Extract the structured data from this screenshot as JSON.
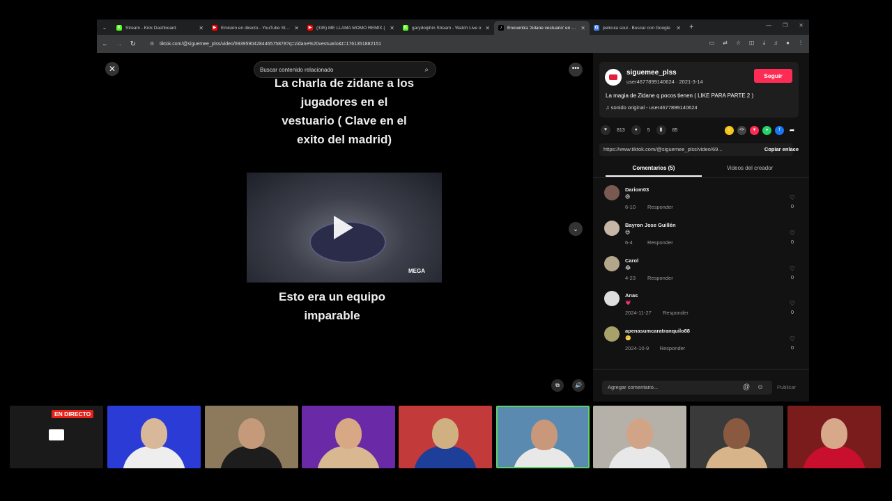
{
  "browser": {
    "tabs": [
      {
        "title": "Stream - Kick Dashboard",
        "fav_color": "#53fc18",
        "fav_char": "K",
        "active": false
      },
      {
        "title": "Emisión en directo - YouTube Studio",
        "fav_color": "#ff0000",
        "fav_char": "▶",
        "active": false
      },
      {
        "title": "(335) ME LLAMA MOMO REMIX (",
        "fav_color": "#ff0000",
        "fav_char": "▶",
        "active": false
      },
      {
        "title": "garydolphin Stream - Watch Live o",
        "fav_color": "#53fc18",
        "fav_char": "K",
        "active": false
      },
      {
        "title": "Encuentra 'zidane vestuario' en TikTok",
        "fav_color": "#000000",
        "fav_char": "♪",
        "active": true
      },
      {
        "title": "pelicula soul - Buscar con Google",
        "fav_color": "#4285f4",
        "fav_char": "G",
        "active": false
      }
    ],
    "url": "tiktok.com/@siguemee_plss/video/6939590428446575878?q=zidane%20vestuario&t=1761351882151"
  },
  "video": {
    "search_placeholder": "Buscar contenido relacionado",
    "title_lines": [
      "La charla de zidane a los",
      "jugadores en el",
      "vestuario ( Clave en el",
      "exito del madrid)"
    ],
    "subtitle_lines": [
      "Esto era un equipo",
      "imparable"
    ],
    "clip_watermark": "MEGA"
  },
  "author": {
    "username": "siguemee_plss",
    "meta": "user4677899140624 · 2021-3-14",
    "follow_label": "Seguir",
    "description": "La magia de Zidane q pocos tienen ( LIKE PARA PARTE 2 )",
    "sound": "sonido original - user4677899140624"
  },
  "stats": {
    "likes": "813",
    "comments": "5",
    "saves": "85"
  },
  "share": {
    "link": "https://www.tiktok.com/@siguemee_plss/video/69...",
    "copy_label": "Copiar enlace"
  },
  "panel_tabs": {
    "comments": "Comentarios (5)",
    "creator": "Videos del creador"
  },
  "comments": [
    {
      "name": "Dariom03",
      "emoji": "😄",
      "date": "6-10",
      "reply": "Responder",
      "likes": "0",
      "avatar": "#7a5a50"
    },
    {
      "name": "Bayron Jose Guillén",
      "emoji": "😍",
      "date": "6-4",
      "reply": "Responder",
      "likes": "0",
      "avatar": "#c7b5a5"
    },
    {
      "name": "Carol",
      "emoji": "😂",
      "date": "4-23",
      "reply": "Responder",
      "likes": "0",
      "avatar": "#b3a68a"
    },
    {
      "name": "Anas",
      "emoji": "💗",
      "date": "2024-11-27",
      "reply": "Responder",
      "likes": "0",
      "avatar": "#dedede"
    },
    {
      "name": "apenasumcaratranquilo88",
      "emoji": "😬",
      "date": "2024-10-9",
      "reply": "Responder",
      "likes": "0",
      "avatar": "#a8a26a"
    }
  ],
  "add_comment": {
    "placeholder": "Agregar comentario...",
    "publish": "Publicar"
  },
  "overlay": {
    "live_badge": "EN DIRECTO",
    "cams": [
      {
        "bg": "#1a1a1a",
        "skin": "#333",
        "shirt": "#222"
      },
      {
        "bg": "#2b3bd6",
        "skin": "#d9b89a",
        "shirt": "#eeeeee"
      },
      {
        "bg": "#8d7a5c",
        "skin": "#c49a7a",
        "shirt": "#1d1d1d"
      },
      {
        "bg": "#6a2aa8",
        "skin": "#d8a884",
        "shirt": "#d8b890"
      },
      {
        "bg": "#c23a3a",
        "skin": "#d0b080",
        "shirt": "#1d3f9a"
      },
      {
        "bg": "#5a8ab0",
        "skin": "#c9987a",
        "shirt": "#e8e8e8"
      },
      {
        "bg": "#b5b1a8",
        "skin": "#d2a487",
        "shirt": "#e8e8e8"
      },
      {
        "bg": "#3a3a3a",
        "skin": "#8a5a40",
        "shirt": "#d8b48a"
      },
      {
        "bg": "#7a1c1c",
        "skin": "#d7a88a",
        "shirt": "#c8102e"
      }
    ]
  }
}
